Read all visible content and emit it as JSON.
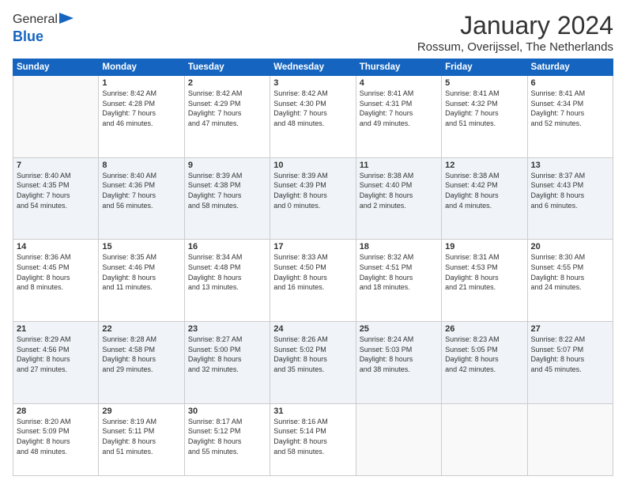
{
  "logo": {
    "general": "General",
    "blue": "Blue"
  },
  "header": {
    "month": "January 2024",
    "location": "Rossum, Overijssel, The Netherlands"
  },
  "days_of_week": [
    "Sunday",
    "Monday",
    "Tuesday",
    "Wednesday",
    "Thursday",
    "Friday",
    "Saturday"
  ],
  "weeks": [
    [
      {
        "day": "",
        "info": ""
      },
      {
        "day": "1",
        "info": "Sunrise: 8:42 AM\nSunset: 4:28 PM\nDaylight: 7 hours\nand 46 minutes."
      },
      {
        "day": "2",
        "info": "Sunrise: 8:42 AM\nSunset: 4:29 PM\nDaylight: 7 hours\nand 47 minutes."
      },
      {
        "day": "3",
        "info": "Sunrise: 8:42 AM\nSunset: 4:30 PM\nDaylight: 7 hours\nand 48 minutes."
      },
      {
        "day": "4",
        "info": "Sunrise: 8:41 AM\nSunset: 4:31 PM\nDaylight: 7 hours\nand 49 minutes."
      },
      {
        "day": "5",
        "info": "Sunrise: 8:41 AM\nSunset: 4:32 PM\nDaylight: 7 hours\nand 51 minutes."
      },
      {
        "day": "6",
        "info": "Sunrise: 8:41 AM\nSunset: 4:34 PM\nDaylight: 7 hours\nand 52 minutes."
      }
    ],
    [
      {
        "day": "7",
        "info": "Sunrise: 8:40 AM\nSunset: 4:35 PM\nDaylight: 7 hours\nand 54 minutes."
      },
      {
        "day": "8",
        "info": "Sunrise: 8:40 AM\nSunset: 4:36 PM\nDaylight: 7 hours\nand 56 minutes."
      },
      {
        "day": "9",
        "info": "Sunrise: 8:39 AM\nSunset: 4:38 PM\nDaylight: 7 hours\nand 58 minutes."
      },
      {
        "day": "10",
        "info": "Sunrise: 8:39 AM\nSunset: 4:39 PM\nDaylight: 8 hours\nand 0 minutes."
      },
      {
        "day": "11",
        "info": "Sunrise: 8:38 AM\nSunset: 4:40 PM\nDaylight: 8 hours\nand 2 minutes."
      },
      {
        "day": "12",
        "info": "Sunrise: 8:38 AM\nSunset: 4:42 PM\nDaylight: 8 hours\nand 4 minutes."
      },
      {
        "day": "13",
        "info": "Sunrise: 8:37 AM\nSunset: 4:43 PM\nDaylight: 8 hours\nand 6 minutes."
      }
    ],
    [
      {
        "day": "14",
        "info": "Sunrise: 8:36 AM\nSunset: 4:45 PM\nDaylight: 8 hours\nand 8 minutes."
      },
      {
        "day": "15",
        "info": "Sunrise: 8:35 AM\nSunset: 4:46 PM\nDaylight: 8 hours\nand 11 minutes."
      },
      {
        "day": "16",
        "info": "Sunrise: 8:34 AM\nSunset: 4:48 PM\nDaylight: 8 hours\nand 13 minutes."
      },
      {
        "day": "17",
        "info": "Sunrise: 8:33 AM\nSunset: 4:50 PM\nDaylight: 8 hours\nand 16 minutes."
      },
      {
        "day": "18",
        "info": "Sunrise: 8:32 AM\nSunset: 4:51 PM\nDaylight: 8 hours\nand 18 minutes."
      },
      {
        "day": "19",
        "info": "Sunrise: 8:31 AM\nSunset: 4:53 PM\nDaylight: 8 hours\nand 21 minutes."
      },
      {
        "day": "20",
        "info": "Sunrise: 8:30 AM\nSunset: 4:55 PM\nDaylight: 8 hours\nand 24 minutes."
      }
    ],
    [
      {
        "day": "21",
        "info": "Sunrise: 8:29 AM\nSunset: 4:56 PM\nDaylight: 8 hours\nand 27 minutes."
      },
      {
        "day": "22",
        "info": "Sunrise: 8:28 AM\nSunset: 4:58 PM\nDaylight: 8 hours\nand 29 minutes."
      },
      {
        "day": "23",
        "info": "Sunrise: 8:27 AM\nSunset: 5:00 PM\nDaylight: 8 hours\nand 32 minutes."
      },
      {
        "day": "24",
        "info": "Sunrise: 8:26 AM\nSunset: 5:02 PM\nDaylight: 8 hours\nand 35 minutes."
      },
      {
        "day": "25",
        "info": "Sunrise: 8:24 AM\nSunset: 5:03 PM\nDaylight: 8 hours\nand 38 minutes."
      },
      {
        "day": "26",
        "info": "Sunrise: 8:23 AM\nSunset: 5:05 PM\nDaylight: 8 hours\nand 42 minutes."
      },
      {
        "day": "27",
        "info": "Sunrise: 8:22 AM\nSunset: 5:07 PM\nDaylight: 8 hours\nand 45 minutes."
      }
    ],
    [
      {
        "day": "28",
        "info": "Sunrise: 8:20 AM\nSunset: 5:09 PM\nDaylight: 8 hours\nand 48 minutes."
      },
      {
        "day": "29",
        "info": "Sunrise: 8:19 AM\nSunset: 5:11 PM\nDaylight: 8 hours\nand 51 minutes."
      },
      {
        "day": "30",
        "info": "Sunrise: 8:17 AM\nSunset: 5:12 PM\nDaylight: 8 hours\nand 55 minutes."
      },
      {
        "day": "31",
        "info": "Sunrise: 8:16 AM\nSunset: 5:14 PM\nDaylight: 8 hours\nand 58 minutes."
      },
      {
        "day": "",
        "info": ""
      },
      {
        "day": "",
        "info": ""
      },
      {
        "day": "",
        "info": ""
      }
    ]
  ]
}
